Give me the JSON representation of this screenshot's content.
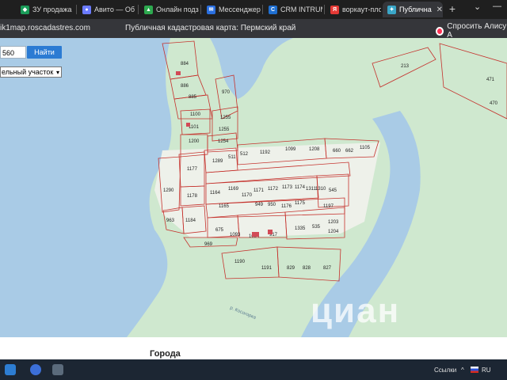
{
  "browser": {
    "tabs": [
      {
        "label": "ЗУ продажа",
        "favicon": "cian-icon",
        "color": "#1a9c59"
      },
      {
        "label": "Авито — Об",
        "favicon": "avito-icon",
        "color": "#6b7bff"
      },
      {
        "label": "Онлайн подз",
        "favicon": "drive-icon",
        "color": "#2da94f"
      },
      {
        "label": "Мессенджер",
        "favicon": "messenger-icon",
        "color": "#2a6fe0"
      },
      {
        "label": "CRM INTRUM",
        "favicon": "crm-icon",
        "color": "#1f6fd1"
      },
      {
        "label": "воркаут-плоц",
        "favicon": "yandex-icon",
        "color": "#e53935"
      },
      {
        "label": "Публична",
        "favicon": "map-icon",
        "color": "#3aa6c8",
        "active": true
      }
    ],
    "close_symbol": "✕",
    "new_tab_symbol": "+",
    "window_controls": [
      "⌄",
      "—"
    ],
    "url": "ik1map.roscadastres.com",
    "page_title": "Публичная кадастровая карта: Пермский край",
    "alice_label": "Спросить Алису А"
  },
  "map": {
    "search_value": "560",
    "find_button": "Найти",
    "select_value": "ельный участок",
    "select_caret": "▾",
    "river_label": "р. Косогорка",
    "watermark": "циан",
    "parcels": [
      "884",
      "886",
      "885",
      "970",
      "1100",
      "1101",
      "1255",
      "1200",
      "1254",
      "1255",
      "1177",
      "1289",
      "511",
      "512",
      "1192",
      "1099",
      "1208",
      "660",
      "662",
      "1105",
      "1290",
      "1178",
      "1164",
      "1169",
      "1170",
      "1171",
      "1172",
      "1173",
      "1174",
      "1311",
      "1310",
      "545",
      "1165",
      "949",
      "950",
      "1176",
      "1175",
      "1197",
      "963",
      "1184",
      "675",
      "1093",
      "1094",
      "917",
      "1335",
      "535",
      "1203",
      "1204",
      "969",
      "1190",
      "1191",
      "829",
      "828",
      "827",
      "213",
      "471",
      "470"
    ]
  },
  "page": {
    "heading": "Города"
  },
  "taskbar": {
    "tray_text": "Ссылки",
    "tray_arrow": "^",
    "tray_lang": "RU"
  }
}
